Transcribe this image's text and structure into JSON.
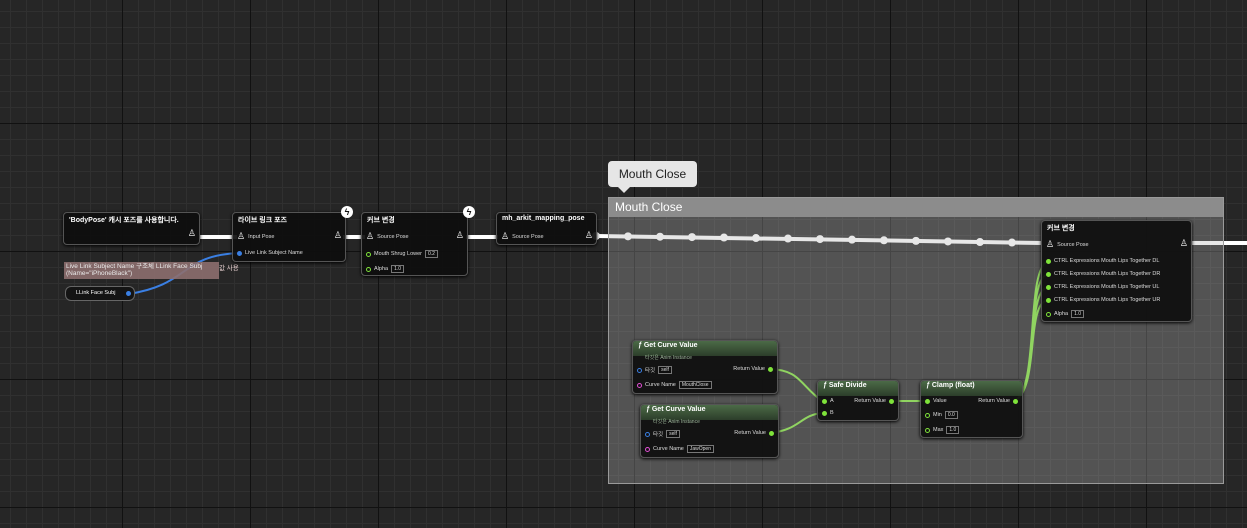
{
  "comment": {
    "bubble": "Mouth Close",
    "title": "Mouth Close"
  },
  "warning": {
    "line1": "Live Link Subject Name 구조체 LLink Face Subj",
    "line1_ext": "값 사용",
    "line2": "(Name=\"iPhoneBlack\")"
  },
  "ref_node": {
    "label": "LLink Face Subj"
  },
  "nodes": {
    "bodypose": {
      "title": "'BodyPose' 캐시 포즈를 사용합니다."
    },
    "livelink": {
      "title": "라이브 링크 포즈",
      "input_pose": "Input Pose",
      "subject": "Live Link Subject Name"
    },
    "curve1": {
      "title": "커브 변경",
      "source_pose": "Source Pose",
      "mouth_shrug": "Mouth Shrug Lower",
      "mouth_shrug_val": "0.2",
      "alpha": "Alpha",
      "alpha_val": "1.0"
    },
    "mapping": {
      "title": "mh_arkit_mapping_pose",
      "source_pose": "Source Pose"
    },
    "curve2": {
      "title": "커브 변경",
      "source_pose": "Source Pose",
      "pins": [
        "CTRL Expressions Mouth Lips Together DL",
        "CTRL Expressions Mouth Lips Together DR",
        "CTRL Expressions Mouth Lips Together UL",
        "CTRL Expressions Mouth Lips Together UR"
      ],
      "alpha": "Alpha",
      "alpha_val": "1.0"
    },
    "getcurve1": {
      "title": "Get Curve Value",
      "subtitle": "타깃은 Anim Instance",
      "target": "타깃",
      "target_val": "self",
      "curve_name": "Curve Name",
      "curve_val": "MouthClose",
      "ret": "Return Value"
    },
    "getcurve2": {
      "title": "Get Curve Value",
      "subtitle": "타깃은 Anim Instance",
      "target": "타깃",
      "target_val": "self",
      "curve_name": "Curve Name",
      "curve_val": "JawOpen",
      "ret": "Return Value"
    },
    "safediv": {
      "title": "Safe Divide",
      "a": "A",
      "b": "B",
      "ret": "Return Value"
    },
    "clamp": {
      "title": "Clamp (float)",
      "value": "Value",
      "min": "Min",
      "min_val": "0.0",
      "max": "Max",
      "max_val": "1.0",
      "ret": "Return Value"
    }
  },
  "icons": {
    "function": "f-icon",
    "pose": "person-icon",
    "fast_path": "lightning-icon"
  },
  "colors": {
    "pose_wire": "#ffffff",
    "float_wire": "#7fe33a",
    "name_wire": "#3a7fe3",
    "comment_header": "#8c8c8c"
  }
}
